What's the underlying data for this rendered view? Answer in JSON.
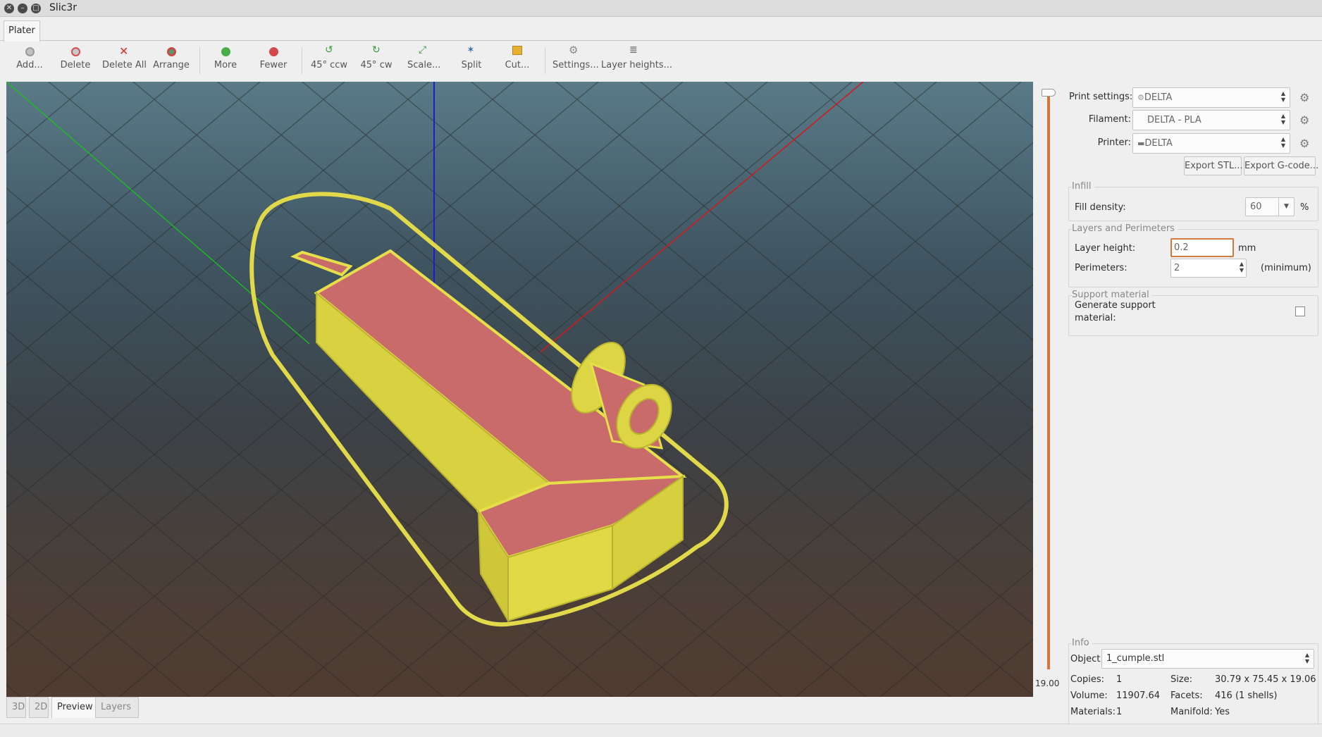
{
  "window": {
    "title": "Slic3r"
  },
  "tabs": {
    "main": "Plater"
  },
  "toolbar": {
    "add": "Add...",
    "delete": "Delete",
    "delete_all": "Delete All",
    "arrange": "Arrange",
    "more": "More",
    "fewer": "Fewer",
    "rotate_ccw": "45° ccw",
    "rotate_cw": "45° cw",
    "scale": "Scale...",
    "split": "Split",
    "cut": "Cut...",
    "settings": "Settings...",
    "layer_heights": "Layer heights..."
  },
  "viewport": {
    "layer_value": "19.00",
    "colors": {
      "object_wall": "#e6df4a",
      "infill": "#c96b6b",
      "axis_x": "#d01010",
      "axis_y": "#10c010",
      "axis_z": "#1010d0",
      "slider": "#d2763e"
    }
  },
  "view_tabs": [
    "3D",
    "2D",
    "Preview",
    "Layers"
  ],
  "view_tabs_active": "Preview",
  "settings": {
    "print_label": "Print settings:",
    "print_value": "DELTA",
    "filament_label": "Filament:",
    "filament_value": "DELTA - PLA",
    "printer_label": "Printer:",
    "printer_value": "DELTA",
    "export_stl": "Export STL...",
    "export_gcode": "Export G-code..."
  },
  "infill": {
    "title": "Infill",
    "fill_density_label": "Fill density:",
    "fill_density_value": "60",
    "fill_density_unit": "%"
  },
  "layers": {
    "title": "Layers and Perimeters",
    "layer_height_label": "Layer height:",
    "layer_height_value": "0.2",
    "layer_height_unit": "mm",
    "perimeters_label": "Perimeters:",
    "perimeters_value": "2",
    "perimeters_unit": "(minimum)"
  },
  "support": {
    "title": "Support material",
    "generate_label_1": "Generate support",
    "generate_label_2": "material:",
    "generate_checked": false
  },
  "info": {
    "title": "Info",
    "object_label": "Object:",
    "object_value": "1_cumple.stl",
    "copies_label": "Copies:",
    "copies_value": "1",
    "size_label": "Size:",
    "size_value": "30.79 x 75.45 x 19.06",
    "volume_label": "Volume:",
    "volume_value": "11907.64",
    "facets_label": "Facets:",
    "facets_value": "416 (1 shells)",
    "materials_label": "Materials:",
    "materials_value": "1",
    "manifold_label": "Manifold:",
    "manifold_value": "Yes"
  }
}
